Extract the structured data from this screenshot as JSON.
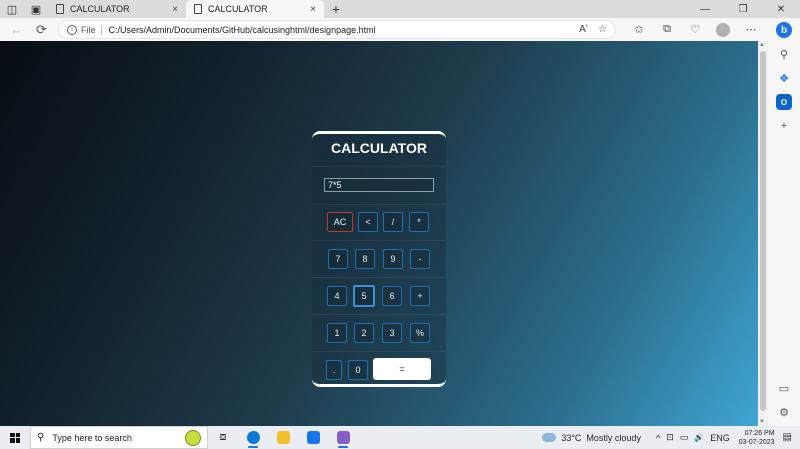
{
  "browser": {
    "tabs": [
      {
        "title": "CALCULATOR",
        "active": false
      },
      {
        "title": "CALCULATOR",
        "active": true
      }
    ],
    "new_tab": "+",
    "close_glyph": "×",
    "window_controls": {
      "minimize": "—",
      "restore": "❐",
      "close": "✕"
    },
    "address": {
      "info_glyph": "i",
      "scheme_label": "File",
      "url": "C:/Users/Admin/Documents/GitHub/calcusinghtml/designpage.html"
    },
    "nav": {
      "back": "←",
      "refresh": "⟳"
    },
    "toolbar_icons": [
      "read-aloud-icon",
      "favorite-star-icon",
      "favorites-icon",
      "collections-icon",
      "browser-essentials-icon",
      "profile-avatar",
      "more-menu-icon"
    ],
    "toolbar_glyphs": {
      "read_aloud": "Aʼ",
      "star": "☆",
      "favorites": "✩",
      "collections": "⧉",
      "essentials": "♡",
      "more": "⋯"
    },
    "sidebar_glyphs": {
      "bing": "b",
      "search": "⚲",
      "copilot": "❖",
      "outlook": "O",
      "add": "+",
      "split": "▭",
      "settings": "⚙"
    }
  },
  "calculator": {
    "title": "CALCULATOR",
    "display_value": "7*5",
    "keys": {
      "ac": "AC",
      "back": "<",
      "divide": "/",
      "multiply": "*",
      "seven": "7",
      "eight": "8",
      "nine": "9",
      "minus": "-",
      "four": "4",
      "five": "5",
      "six": "6",
      "plus": "+",
      "one": "1",
      "two": "2",
      "three": "3",
      "percent": "%",
      "dot": ".",
      "zero": "0",
      "equals": "="
    }
  },
  "taskbar": {
    "search_placeholder": "Type here to search",
    "search_glyph": "⚲",
    "taskview_glyph": "⧈",
    "weather_temp": "33°C",
    "weather_desc": "Mostly cloudy",
    "tray_glyphs": {
      "chevron": "^",
      "network": "⊡",
      "battery": "▭",
      "volume": "🔊"
    },
    "language": "ENG",
    "time": "07:26 PM",
    "date": "03-07-2023",
    "notification_glyph": "▤",
    "colors": {
      "edge": "#0c7bd8",
      "explorer": "#f2c02a",
      "mail": "#1a73e8",
      "vs": "#865fc5"
    }
  }
}
